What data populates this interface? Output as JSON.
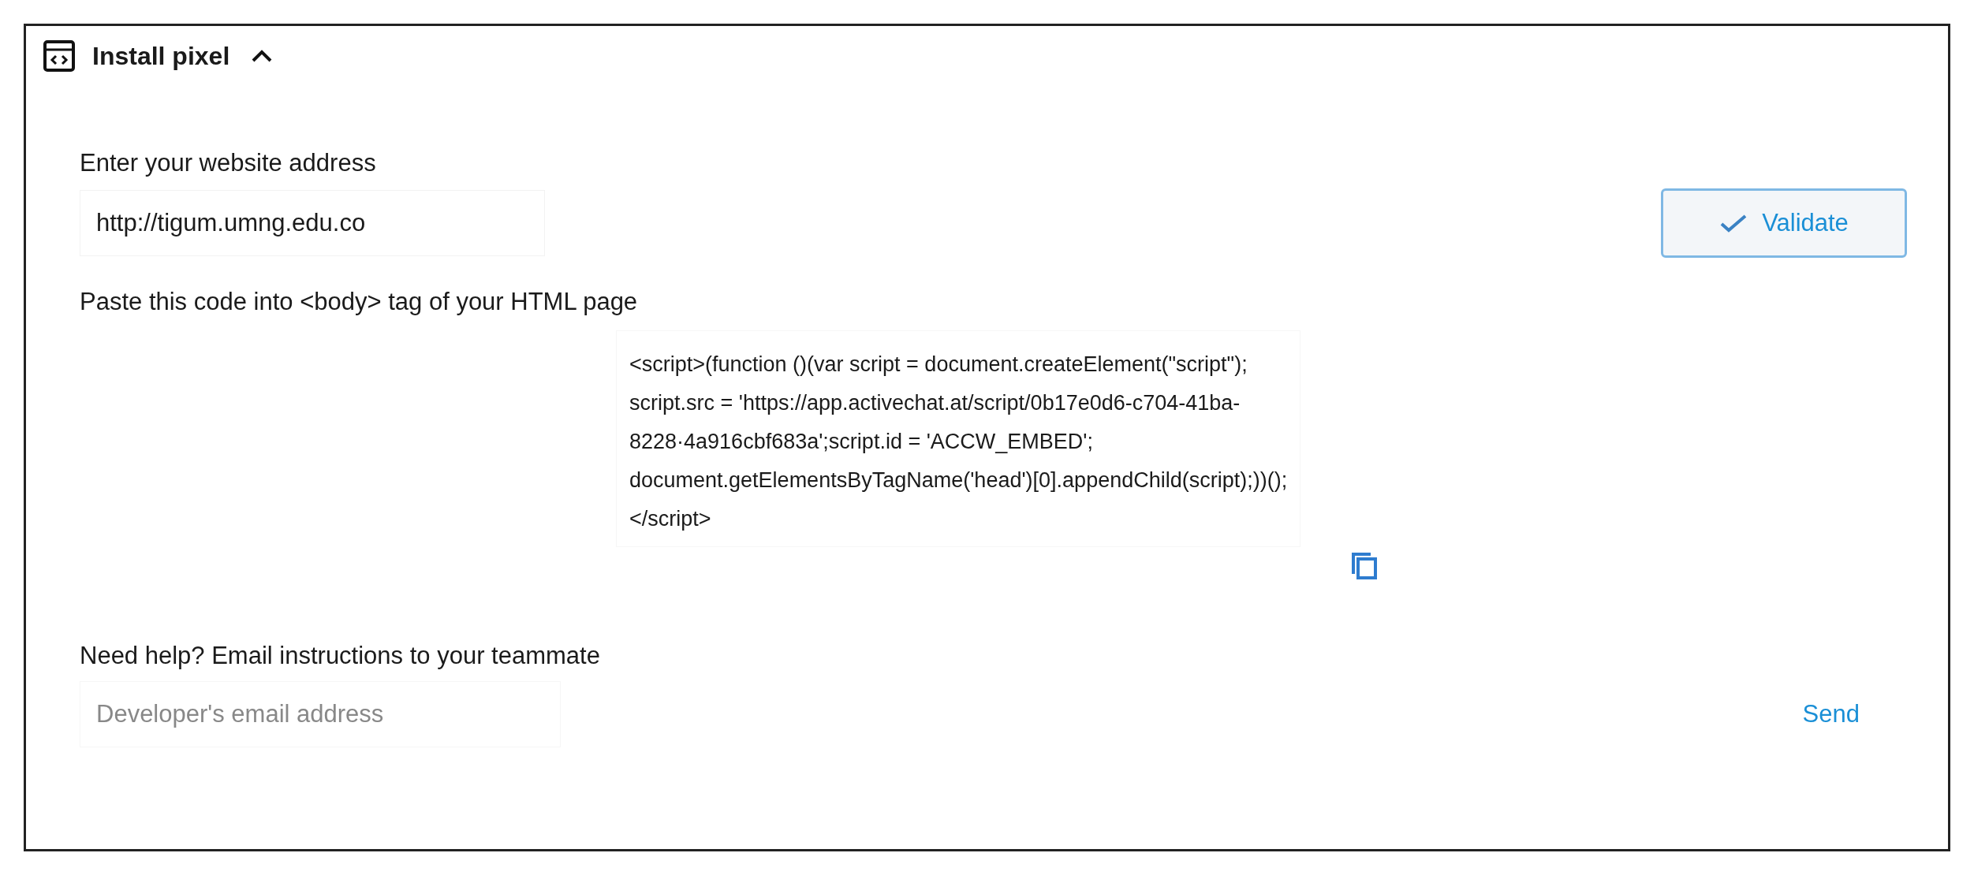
{
  "panel": {
    "title": "Install pixel",
    "expanded": true
  },
  "website": {
    "label": "Enter your website address",
    "value": "http://tigum.umng.edu.co",
    "button": "Validate"
  },
  "code": {
    "label": "Paste this code into <body> tag of your HTML page",
    "lines": [
      "<script>(function ()(var script = document.createElement(\"script\");",
      "script.src = 'https://app.activechat.at/script/0b17e0d6-c704-41ba-",
      "8228·4a916cbf683a';script.id = 'ACCW_EMBED';",
      "document.getElementsByTagName('head')[0].appendChild(script);))();",
      "</script>"
    ]
  },
  "help": {
    "label": "Need help? Email instructions to your teammate",
    "placeholder": "Developer's email address",
    "button": "Send"
  }
}
